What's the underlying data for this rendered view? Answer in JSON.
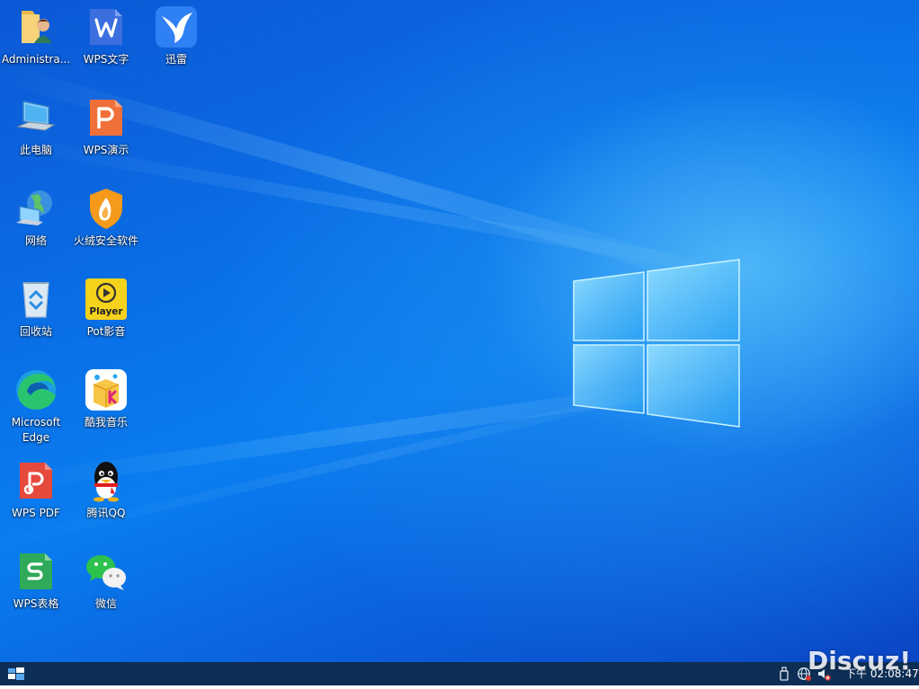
{
  "desktop_icons": [
    {
      "name": "folder-user-icon",
      "label": "Administra..."
    },
    {
      "name": "wps-writer-icon",
      "label": "WPS文字"
    },
    {
      "name": "xunlei-icon",
      "label": "迅雷"
    },
    {
      "name": "this-pc-icon",
      "label": "此电脑"
    },
    {
      "name": "wps-presentation-icon",
      "label": "WPS演示"
    },
    {
      "name": "network-icon",
      "label": "网络"
    },
    {
      "name": "huorong-icon",
      "label": "火绒安全软件"
    },
    {
      "name": "recycle-bin-icon",
      "label": "回收站"
    },
    {
      "name": "potplayer-icon",
      "label": "Pot影音",
      "glyph_text": "Player"
    },
    {
      "name": "edge-icon",
      "label": "Microsoft Edge"
    },
    {
      "name": "kuwo-icon",
      "label": "酷我音乐"
    },
    {
      "name": "wps-pdf-icon",
      "label": "WPS PDF"
    },
    {
      "name": "qq-icon",
      "label": "腾讯QQ"
    },
    {
      "name": "wps-spreadsheet-icon",
      "label": "WPS表格"
    },
    {
      "name": "wechat-icon",
      "label": "微信"
    }
  ],
  "taskbar": {
    "start_icon": "windows-start-icon",
    "clock": "下午 02:08:47"
  },
  "watermark": "Discuz!",
  "colors": {
    "taskbar": "#0d2e55",
    "wallpaper_accent": "#0a7df0"
  }
}
